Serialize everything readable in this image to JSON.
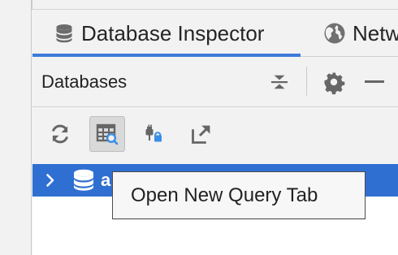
{
  "tabs": [
    {
      "label": "Database Inspector",
      "icon": "database-icon",
      "active": true
    },
    {
      "label": "Netw",
      "icon": "globe-icon",
      "active": false
    }
  ],
  "panel": {
    "title": "Databases",
    "header_icons": [
      "collapse-icon",
      "gear-icon",
      "minimize-icon"
    ]
  },
  "toolbar": {
    "icons": [
      "refresh-icon",
      "query-table-icon",
      "plug-lock-icon",
      "export-icon"
    ],
    "pressed_icon": "query-table-icon"
  },
  "tree": {
    "selected_row": {
      "label": "a",
      "icons": [
        "chevron-right-icon",
        "database-icon"
      ]
    }
  },
  "tooltip": {
    "text": "Open New Query Tab"
  },
  "colors": {
    "accent": "#3d7bd9",
    "selection": "#2f6fd2",
    "icon": "#5f6368",
    "inspector_blue": "#3a8ee6"
  }
}
